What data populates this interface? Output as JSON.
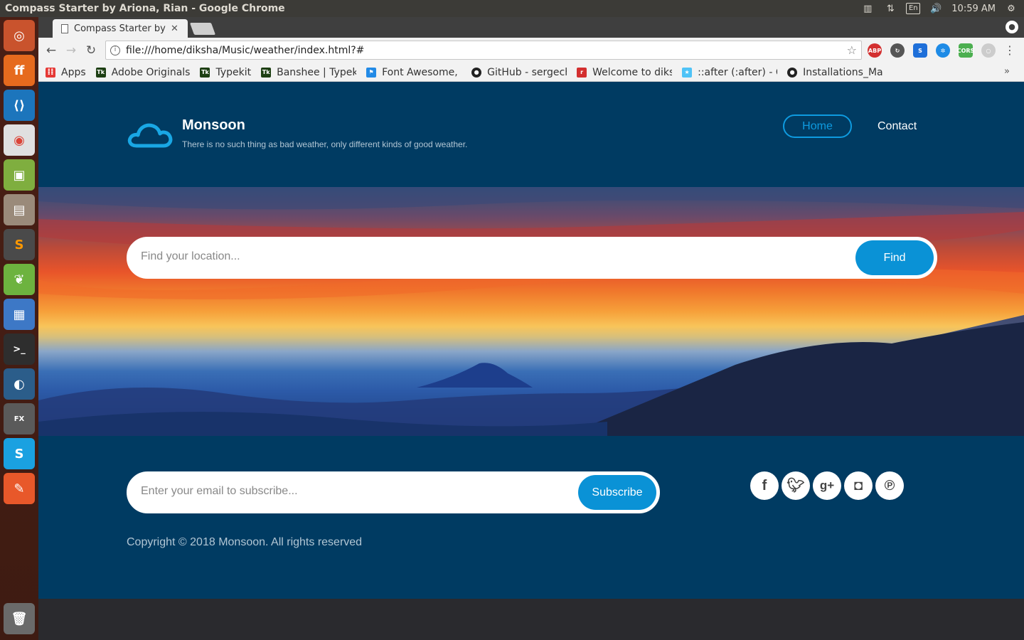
{
  "os": {
    "window_title": "Compass Starter by Ariona, Rian - Google Chrome",
    "clock": "10:59 AM",
    "keyboard_layout": "En"
  },
  "browser": {
    "tab_title": "Compass Starter by Ariona, Rian",
    "url": "file:///home/diksha/Music/weather/index.html?#",
    "bookmarks": [
      {
        "label": "Apps"
      },
      {
        "label": "Adobe Originals"
      },
      {
        "label": "Typekit"
      },
      {
        "label": "Banshee | Typekit"
      },
      {
        "label": "Font Awesome, Font"
      },
      {
        "label": "GitHub - sergech"
      },
      {
        "label": "Welcome to diksha"
      },
      {
        "label": "::after (:after) - CSS"
      },
      {
        "label": "Installations_Ma"
      }
    ]
  },
  "site": {
    "brand_name": "Monsoon",
    "tagline": "There is no such thing as bad weather, only different kinds of good weather.",
    "nav": {
      "home": "Home",
      "contact": "Contact"
    },
    "search": {
      "placeholder": "Find your location...",
      "button": "Find"
    },
    "subscribe": {
      "placeholder": "Enter your email to subscribe...",
      "button": "Subscribe"
    },
    "social_icons": [
      "facebook-icon",
      "twitter-icon",
      "google-plus-icon",
      "instagram-icon",
      "pinterest-icon"
    ],
    "copyright": "Copyright © 2018 Monsoon. All rights reserved"
  },
  "colors": {
    "page_bg": "#003b62",
    "accent": "#0a92d6",
    "launcher_bg": "#4a1f15"
  }
}
